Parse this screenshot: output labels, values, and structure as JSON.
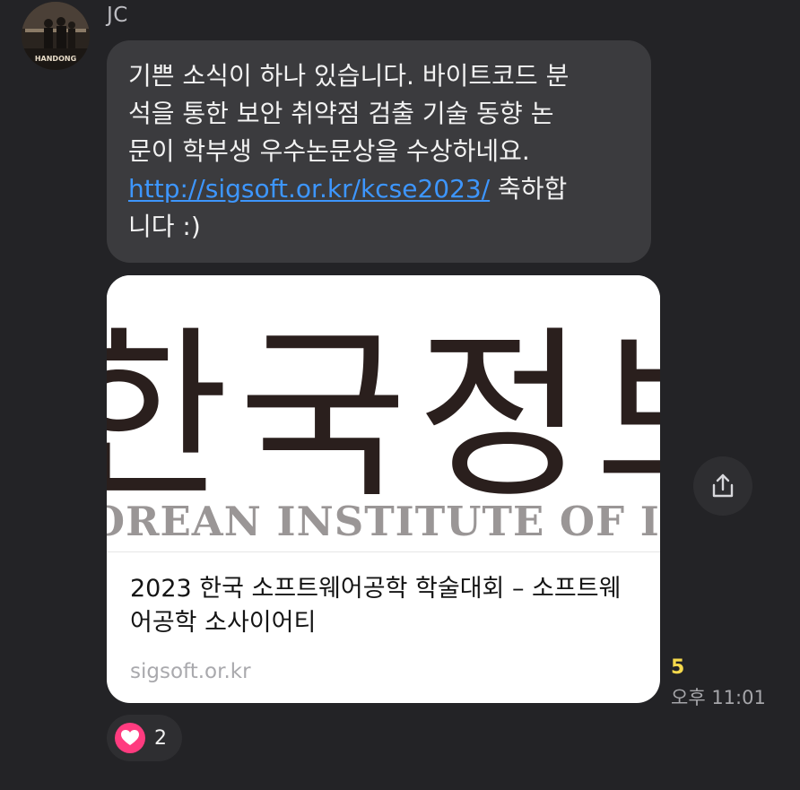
{
  "sender": {
    "name": "JC",
    "avatar_text": "HANDONG"
  },
  "message": {
    "lines": [
      "기쁜 소식이 하나 있습니다. 바이트코드 분",
      "석을 통한 보안 취약점 검출 기술 동향 논",
      "문이 학부생 우수논문상을 수상하네요."
    ],
    "link": "http://sigsoft.or.kr/kcse2023/",
    "link_suffix": " 축하합",
    "last_line": "니다 :)"
  },
  "link_preview": {
    "image_title_korean": "한국정보과",
    "image_subtitle_english": "KOREAN INSTITUTE OF INFORMATION SCIENCE",
    "title": "2023 한국 소프트웨어공학 학술대회 – 소프트웨어공학 소사이어티",
    "domain": "sigsoft.or.kr"
  },
  "share_button": {
    "icon": "share-icon"
  },
  "meta": {
    "unread_count": "5",
    "time": "오후 11:01"
  },
  "reaction": {
    "icon": "heart-icon",
    "count": "2",
    "color": "#ff3b7f"
  },
  "colors": {
    "background": "#232326",
    "bubble": "#3b3b3e",
    "link": "#3d96ff",
    "unread": "#f5d94c"
  }
}
